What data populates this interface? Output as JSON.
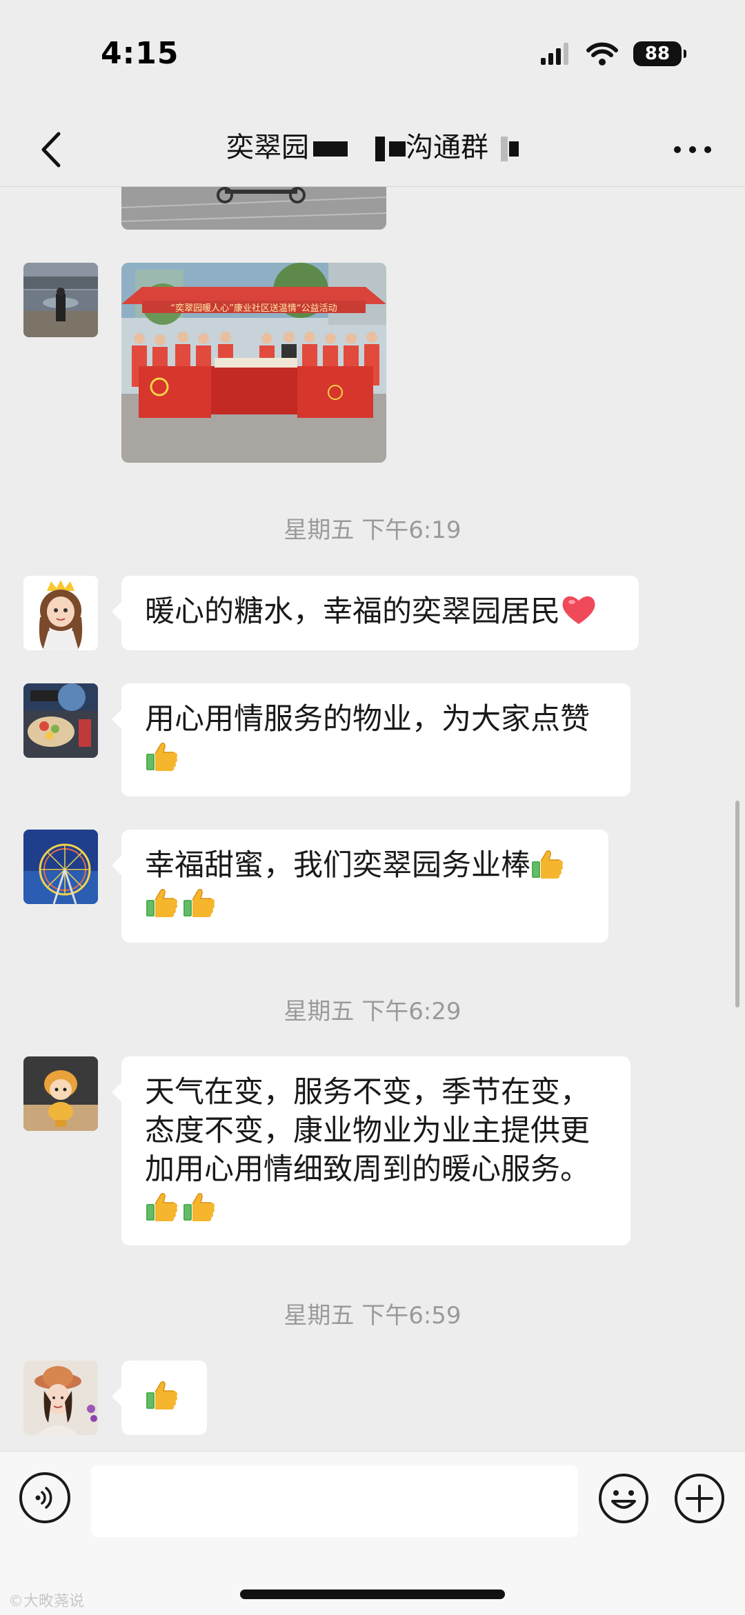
{
  "status_bar": {
    "time": "4:15",
    "battery": "88"
  },
  "header": {
    "title_prefix": "奕翠园",
    "title_suffix": "沟通群",
    "back_icon": "chevron-left-icon",
    "more_icon": "more-dots-icon"
  },
  "messages": [
    {
      "type": "image",
      "avatar_icon": "avatar-street",
      "banner_text": "“奕翠园暖人心”康业社区送温情“公益活动"
    },
    {
      "type": "timestamp",
      "text": "星期五 下午6:19"
    },
    {
      "type": "text",
      "avatar_icon": "avatar-cartoon-girl",
      "text": "暖心的糖水，幸福的奕翠园居民",
      "emoji": [
        "heart-icon"
      ]
    },
    {
      "type": "text",
      "avatar_icon": "avatar-cake",
      "text": "用心用情服务的物业，为大家点赞",
      "emoji": [
        "thumbs-up-icon"
      ]
    },
    {
      "type": "text",
      "avatar_icon": "avatar-ferris-wheel",
      "text": "幸福甜蜜，我们奕翠园务业棒",
      "emoji": [
        "thumbs-up-icon",
        "thumbs-up-icon",
        "thumbs-up-icon"
      ]
    },
    {
      "type": "timestamp",
      "text": "星期五 下午6:29"
    },
    {
      "type": "text",
      "avatar_icon": "avatar-doll",
      "lines": [
        "天气在变，服务不变，季节在变，",
        "态度不变，康业物业为业主提供更",
        "加用心用情细致周到的暖心服务。"
      ],
      "emoji": [
        "thumbs-up-icon",
        "thumbs-up-icon"
      ]
    },
    {
      "type": "timestamp",
      "text": "星期五 下午6:59"
    },
    {
      "type": "emoji",
      "avatar_icon": "avatar-woman-hat",
      "emoji": [
        "thumbs-up-icon"
      ]
    }
  ],
  "input_bar": {
    "placeholder": "",
    "voice_icon": "voice-icon",
    "emoji_icon": "emoji-icon",
    "plus_icon": "plus-icon"
  },
  "watermark": "©大畋荛说"
}
